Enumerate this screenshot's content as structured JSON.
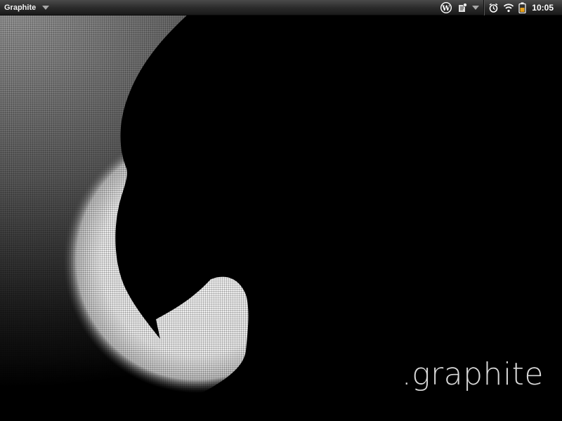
{
  "statusbar": {
    "app_title": "Graphite",
    "clock": "10:05",
    "icons": [
      "wordpress-icon",
      "notification-icon",
      "chevron-down-icon",
      "alarm-icon",
      "wifi-icon",
      "battery-icon"
    ]
  },
  "wallpaper": {
    "brand_text": ".graphite",
    "colors": {
      "background": "#000000",
      "glow": "#f2f2f2",
      "haze": "#8a8a8a",
      "text": "#d9d9d9"
    }
  }
}
